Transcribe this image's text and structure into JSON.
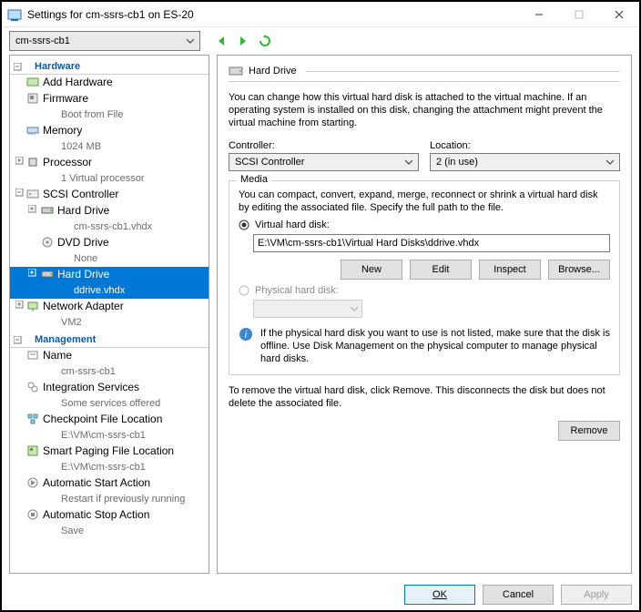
{
  "window_title": "Settings for cm-ssrs-cb1 on ES-20",
  "vm_dropdown": "cm-ssrs-cb1",
  "sections": {
    "hardware": "Hardware",
    "management": "Management"
  },
  "tree": {
    "add_hardware": "Add Hardware",
    "firmware": "Firmware",
    "firmware_sub": "Boot from File",
    "memory": "Memory",
    "memory_sub": "1024 MB",
    "processor": "Processor",
    "processor_sub": "1 Virtual processor",
    "scsi": "SCSI Controller",
    "hd1": "Hard Drive",
    "hd1_sub": "cm-ssrs-cb1.vhdx",
    "dvd": "DVD Drive",
    "dvd_sub": "None",
    "hd2": "Hard Drive",
    "hd2_sub": "ddrive.vhdx",
    "net": "Network Adapter",
    "net_sub": "VM2",
    "name": "Name",
    "name_sub": "cm-ssrs-cb1",
    "integ": "Integration Services",
    "integ_sub": "Some services offered",
    "chk": "Checkpoint File Location",
    "chk_sub": "E:\\VM\\cm-ssrs-cb1",
    "smart": "Smart Paging File Location",
    "smart_sub": "E:\\VM\\cm-ssrs-cb1",
    "autostart": "Automatic Start Action",
    "autostart_sub": "Restart if previously running",
    "autostop": "Automatic Stop Action",
    "autostop_sub": "Save"
  },
  "panel": {
    "title": "Hard Drive",
    "descr": "You can change how this virtual hard disk is attached to the virtual machine. If an operating system is installed on this disk, changing the attachment might prevent the virtual machine from starting.",
    "controller_lbl": "Controller:",
    "controller_val": "SCSI Controller",
    "location_lbl": "Location:",
    "location_val": "2 (in use)",
    "media_title": "Media",
    "media_descr": "You can compact, convert, expand, merge, reconnect or shrink a virtual hard disk by editing the associated file. Specify the full path to the file.",
    "vhd_label": "Virtual hard disk:",
    "vhd_path": "E:\\VM\\cm-ssrs-cb1\\Virtual Hard Disks\\ddrive.vhdx",
    "btn_new": "New",
    "btn_edit": "Edit",
    "btn_inspect": "Inspect",
    "btn_browse": "Browse...",
    "phd_label": "Physical hard disk:",
    "info_text": "If the physical hard disk you want to use is not listed, make sure that the disk is offline. Use Disk Management on the physical computer to manage physical hard disks.",
    "remove_text": "To remove the virtual hard disk, click Remove. This disconnects the disk but does not delete the associated file.",
    "btn_remove": "Remove"
  },
  "footer": {
    "ok": "OK",
    "cancel": "Cancel",
    "apply": "Apply"
  }
}
